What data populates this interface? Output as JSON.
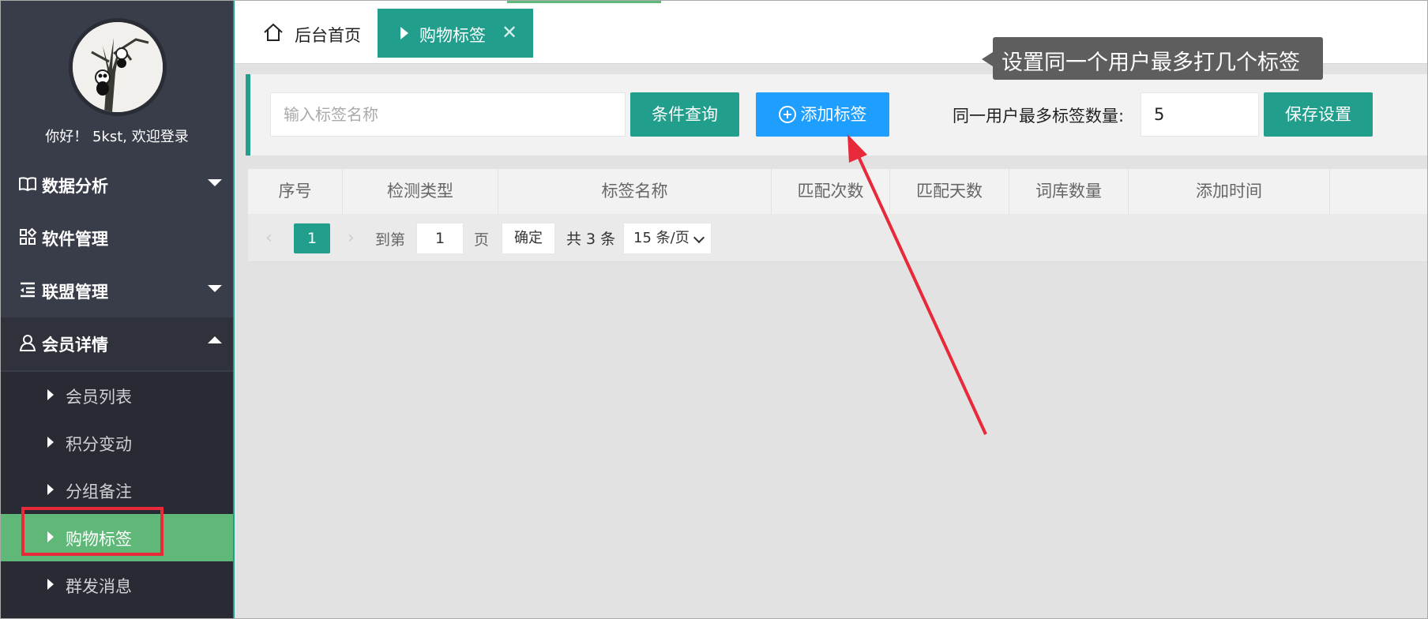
{
  "sidebar": {
    "welcome": "你好！ 5kst, 欢迎登录",
    "menu": [
      {
        "label": "数据分析",
        "icon": "book-icon",
        "expandable": true,
        "expanded": false
      },
      {
        "label": "软件管理",
        "icon": "apps-grid-icon",
        "expandable": false
      },
      {
        "label": "联盟管理",
        "icon": "indent-list-icon",
        "expandable": true,
        "expanded": false
      },
      {
        "label": "会员详情",
        "icon": "user-icon",
        "expandable": true,
        "expanded": true
      }
    ],
    "submenu": [
      {
        "label": "会员列表",
        "active": false
      },
      {
        "label": "积分变动",
        "active": false
      },
      {
        "label": "分组备注",
        "active": false
      },
      {
        "label": "购物标签",
        "active": true
      },
      {
        "label": "群发消息",
        "active": false
      }
    ]
  },
  "tabs": {
    "home": "后台首页",
    "active": "购物标签",
    "close_glyph": "✕"
  },
  "tooltip": "设置同一个用户最多打几个标签",
  "toolbar": {
    "search_placeholder": "输入标签名称",
    "query_button": "条件查询",
    "add_button": "添加标签",
    "max_label": "同一用户最多标签数量:",
    "max_value": "5",
    "save_button": "保存设置"
  },
  "table": {
    "columns": [
      "序号",
      "检测类型",
      "标签名称",
      "匹配次数",
      "匹配天数",
      "词库数量",
      "添加时间"
    ]
  },
  "pager": {
    "prev": "‹",
    "current_page": "1",
    "next": "›",
    "goto_label": "到第",
    "goto_value": "1",
    "page_unit": "页",
    "confirm": "确定",
    "total": "共 3 条",
    "page_size": "15 条/页"
  },
  "colors": {
    "sidebar_bg": "#393d49",
    "accent_teal": "#229e8c",
    "active_green": "#5fb878",
    "blue_button": "#1e9fff",
    "annotation_red": "#e8293a"
  }
}
